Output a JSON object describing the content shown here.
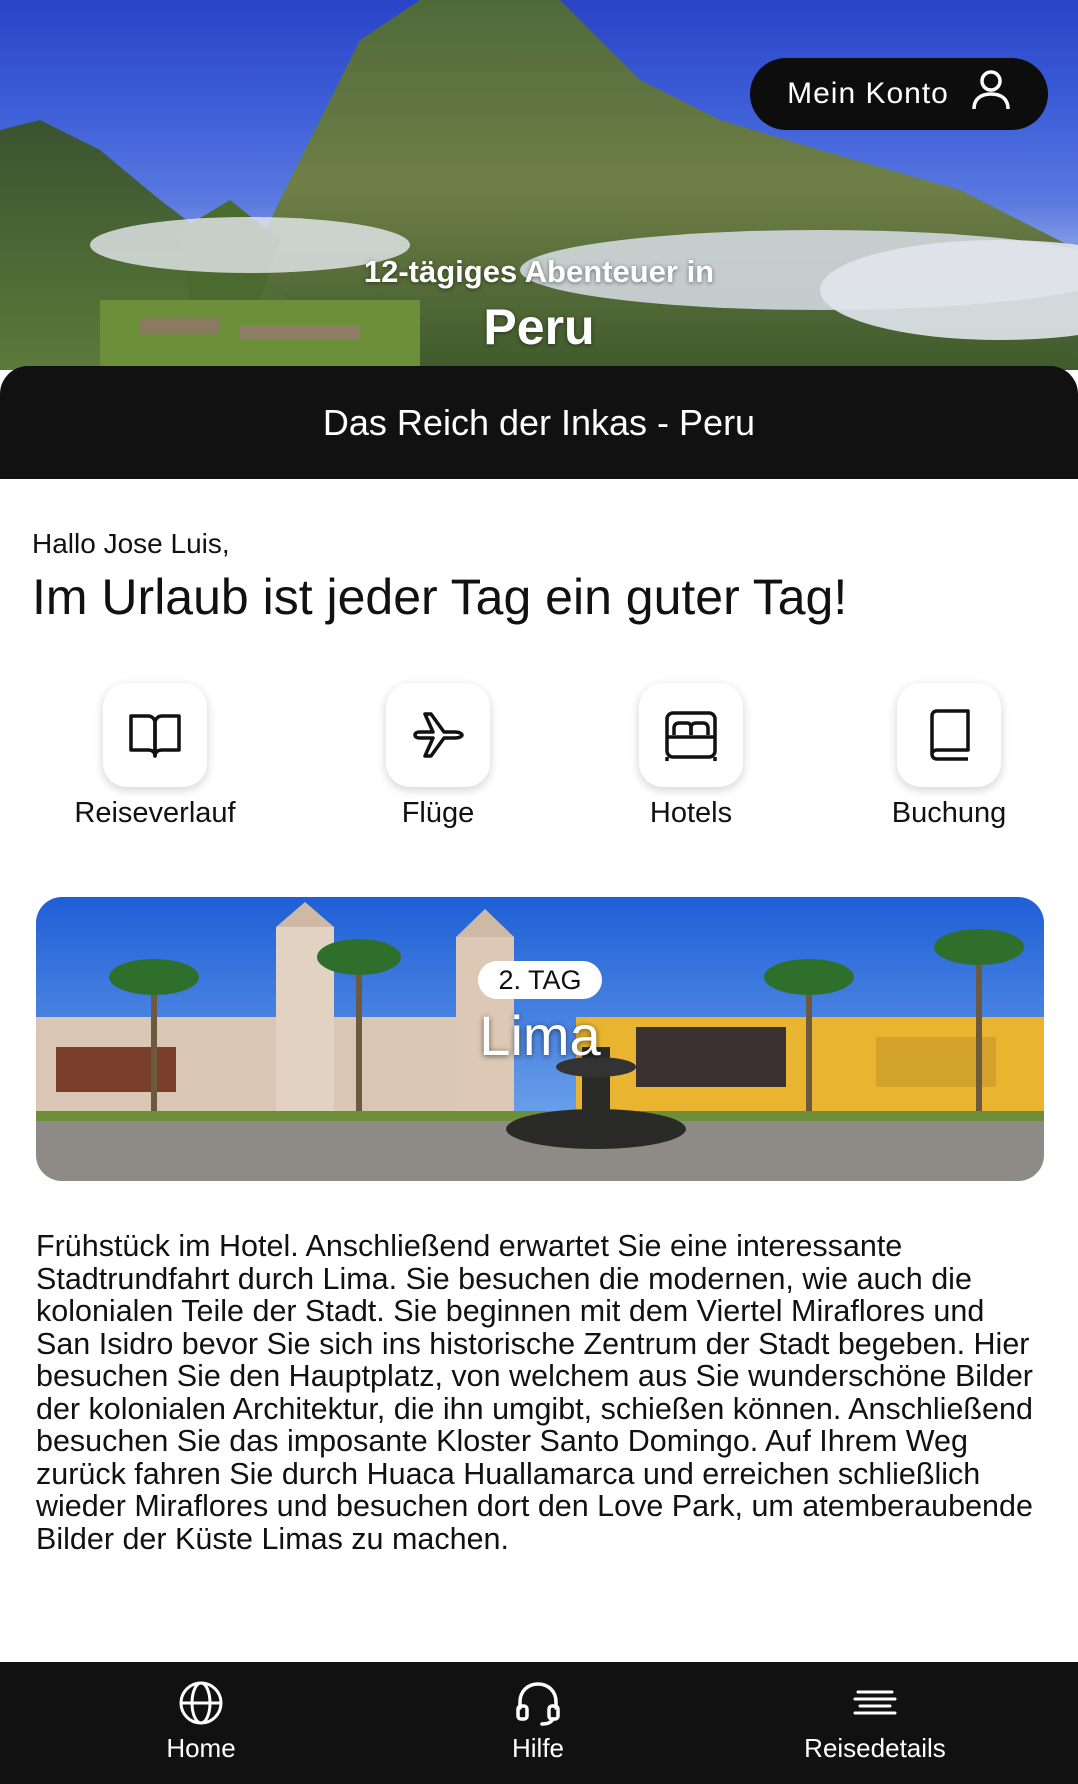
{
  "account": {
    "label": "Mein Konto",
    "icon": "user-icon"
  },
  "hero": {
    "subtitle": "12-tägiges Abenteuer in",
    "title": "Peru"
  },
  "tour": {
    "name": "Das Reich der Inkas - Peru"
  },
  "welcome": {
    "greeting": "Hallo Jose Luis,",
    "headline": "Im Urlaub ist jeder Tag ein guter Tag!"
  },
  "quick_links": [
    {
      "label": "Reiseverlauf",
      "icon": "open-book-icon"
    },
    {
      "label": "Flüge",
      "icon": "airplane-icon"
    },
    {
      "label": "Hotels",
      "icon": "bed-icon"
    },
    {
      "label": "Buchung",
      "icon": "book-icon"
    }
  ],
  "day": {
    "badge": "2. TAG",
    "city": "Lima",
    "description": "Frühstück im Hotel. Anschließend erwartet Sie eine interessante Stadtrundfahrt durch Lima. Sie besuchen die modernen, wie auch die kolonialen Teile der Stadt. Sie beginnen mit dem Viertel Miraflores und San Isidro bevor Sie sich ins historische Zentrum der Stadt begeben. Hier besuchen Sie den Hauptplatz, von welchem aus Sie wunderschöne Bilder der kolonialen Architektur, die ihn umgibt, schießen können. Anschließend besuchen Sie das imposante Kloster Santo Domingo. Auf Ihrem Weg zurück fahren Sie durch Huaca Huallamarca und erreichen schließlich wieder Miraflores und besuchen dort den Love Park, um atemberaubende Bilder der Küste Limas zu machen."
  },
  "nav": [
    {
      "label": "Home",
      "icon": "globe-icon"
    },
    {
      "label": "Hilfe",
      "icon": "headset-icon"
    },
    {
      "label": "Reisedetails",
      "icon": "menu-lines-icon"
    }
  ],
  "colors": {
    "dark": "#111111",
    "sky": "#2f4fd0",
    "facade_yellow": "#e9b531"
  }
}
